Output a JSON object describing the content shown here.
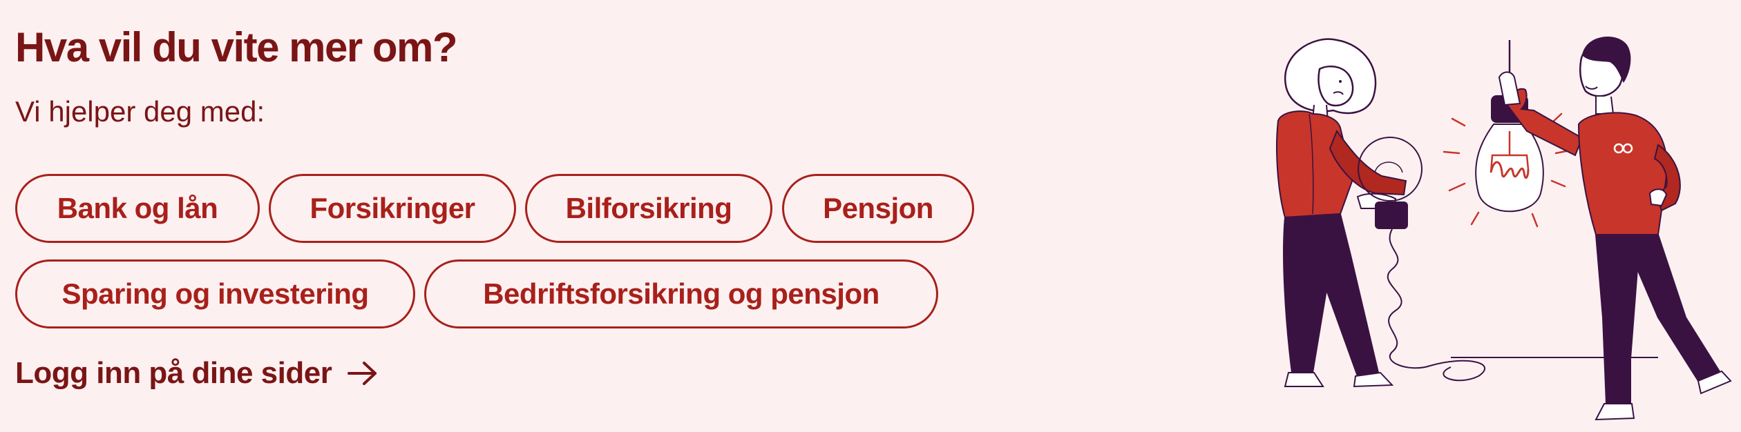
{
  "section": {
    "title": "Hva vil du vite mer om?",
    "subtitle": "Vi hjelper deg med:"
  },
  "topics": [
    {
      "label": "Bank og lån"
    },
    {
      "label": "Forsikringer"
    },
    {
      "label": "Bilforsikring"
    },
    {
      "label": "Pensjon"
    },
    {
      "label": "Sparing og investering"
    },
    {
      "label": "Bedriftsforsikring og pensjon"
    }
  ],
  "login": {
    "label": "Logg inn på dine sider",
    "icon": "arrow-right-icon"
  },
  "colors": {
    "background": "#fdf0f1",
    "heading": "#7a1515",
    "accent": "#a8201a",
    "illustration_red": "#c8352a",
    "illustration_purple": "#3a1242"
  }
}
